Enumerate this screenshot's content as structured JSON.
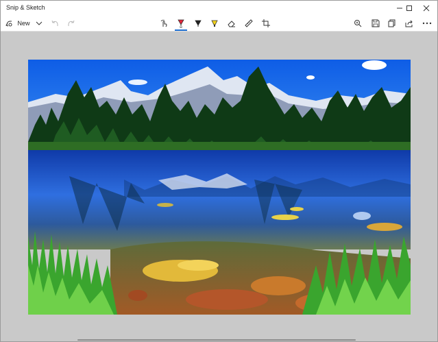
{
  "app": {
    "title": "Snip & Sketch"
  },
  "window_controls": {
    "minimize": "—",
    "maximize": "☐",
    "close": "✕"
  },
  "toolbar": {
    "new_label": "New"
  },
  "icons": {
    "new": "new-snip-icon",
    "dropdown": "chevron-down-icon",
    "undo": "undo-icon",
    "redo": "redo-icon",
    "touch": "touch-writing-icon",
    "ballpoint": "ballpoint-pen-icon",
    "pencil": "pencil-icon",
    "highlighter": "highlighter-icon",
    "eraser": "eraser-icon",
    "ruler": "ruler-icon",
    "crop": "crop-icon",
    "zoom": "zoom-icon",
    "save": "save-icon",
    "copy": "copy-icon",
    "share": "share-icon",
    "more": "more-icon"
  },
  "colors": {
    "accent": "#1f6fd1",
    "ballpoint_pen": "#e8243a",
    "pencil": "#222222",
    "highlighter": "#f2d21a",
    "canvas_bg": "#c9c9c9"
  },
  "image": {
    "description_icon": "landscape-photo"
  }
}
